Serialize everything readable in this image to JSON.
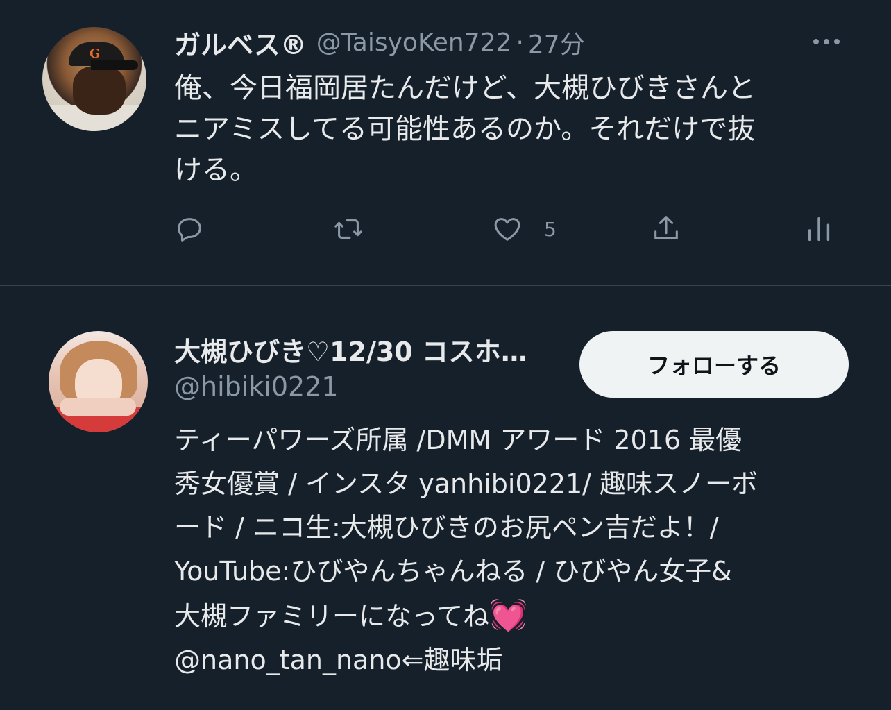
{
  "tweet": {
    "display_name": "ガルベス®",
    "handle": "@TaisyoKen722",
    "separator": "·",
    "time": "27分",
    "text": "俺、今日福岡居たんだけど、大槻ひびきさんと\nニアミスしてる可能性あるのか。それだけで抜\nける。",
    "actions": {
      "reply_count": "",
      "retweet_count": "",
      "like_count": "5",
      "share_count": ""
    }
  },
  "account_card": {
    "display_name": "大槻ひびき♡12/30 コスホ…",
    "handle": "@hibiki0221",
    "follow_label": "フォローする",
    "bio": "ティーパワーズ所属 /DMM アワード 2016 最優\n秀女優賞 / インスタ yanhibi0221/ 趣味スノーボ\nード / ニコ生:大槻ひびきのお尻ペン吉だよ！/\nYouTube:ひびやんちゃんねる / ひびやん女子&\n大槻ファミリーになってね",
    "bio_emoji": "💓",
    "bio_tail": "@nano_tan_nano⇐趣味垢"
  },
  "colors": {
    "background": "#15202b",
    "text": "#e7e9ea",
    "secondary_text": "#8b98a5",
    "follow_button_bg": "#eff3f4"
  }
}
